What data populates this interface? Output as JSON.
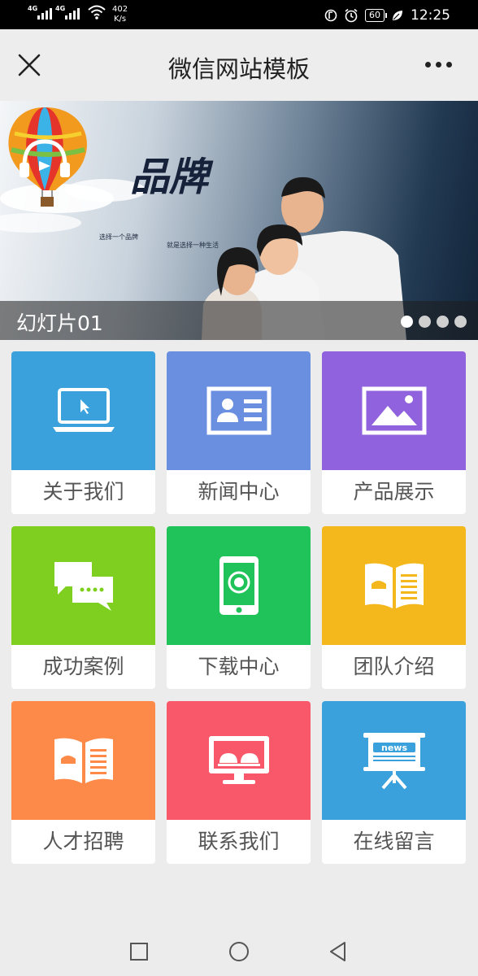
{
  "status_bar": {
    "signal1_label": "4G",
    "signal2_label": "4G",
    "net_speed_value": "402",
    "net_speed_unit": "K/s",
    "battery": "60",
    "time": "12:25"
  },
  "titlebar": {
    "title": "微信网站模板"
  },
  "banner": {
    "brand_text": "品牌",
    "slogan_left": "选择一个品牌",
    "slogan_right": "就是选择一种生活",
    "caption": "幻灯片01",
    "slide_count": 4,
    "active_slide": 1
  },
  "tiles": [
    {
      "label": "关于我们",
      "color": "#3aa1dc",
      "icon": "laptop-icon"
    },
    {
      "label": "新闻中心",
      "color": "#6b8fe0",
      "icon": "id-card-icon"
    },
    {
      "label": "产品展示",
      "color": "#9062dd",
      "icon": "image-icon"
    },
    {
      "label": "成功案例",
      "color": "#7fcf21",
      "icon": "chat-bubbles-icon"
    },
    {
      "label": "下载中心",
      "color": "#1fc359",
      "icon": "phone-icon"
    },
    {
      "label": "团队介绍",
      "color": "#f4b81d",
      "icon": "open-book-icon"
    },
    {
      "label": "人才招聘",
      "color": "#fd8a49",
      "icon": "open-book-icon"
    },
    {
      "label": "联系我们",
      "color": "#f8586a",
      "icon": "monitor-icon"
    },
    {
      "label": "在线留言",
      "color": "#3aa1dc",
      "icon": "news-board-icon"
    }
  ],
  "news_board_text": "news"
}
